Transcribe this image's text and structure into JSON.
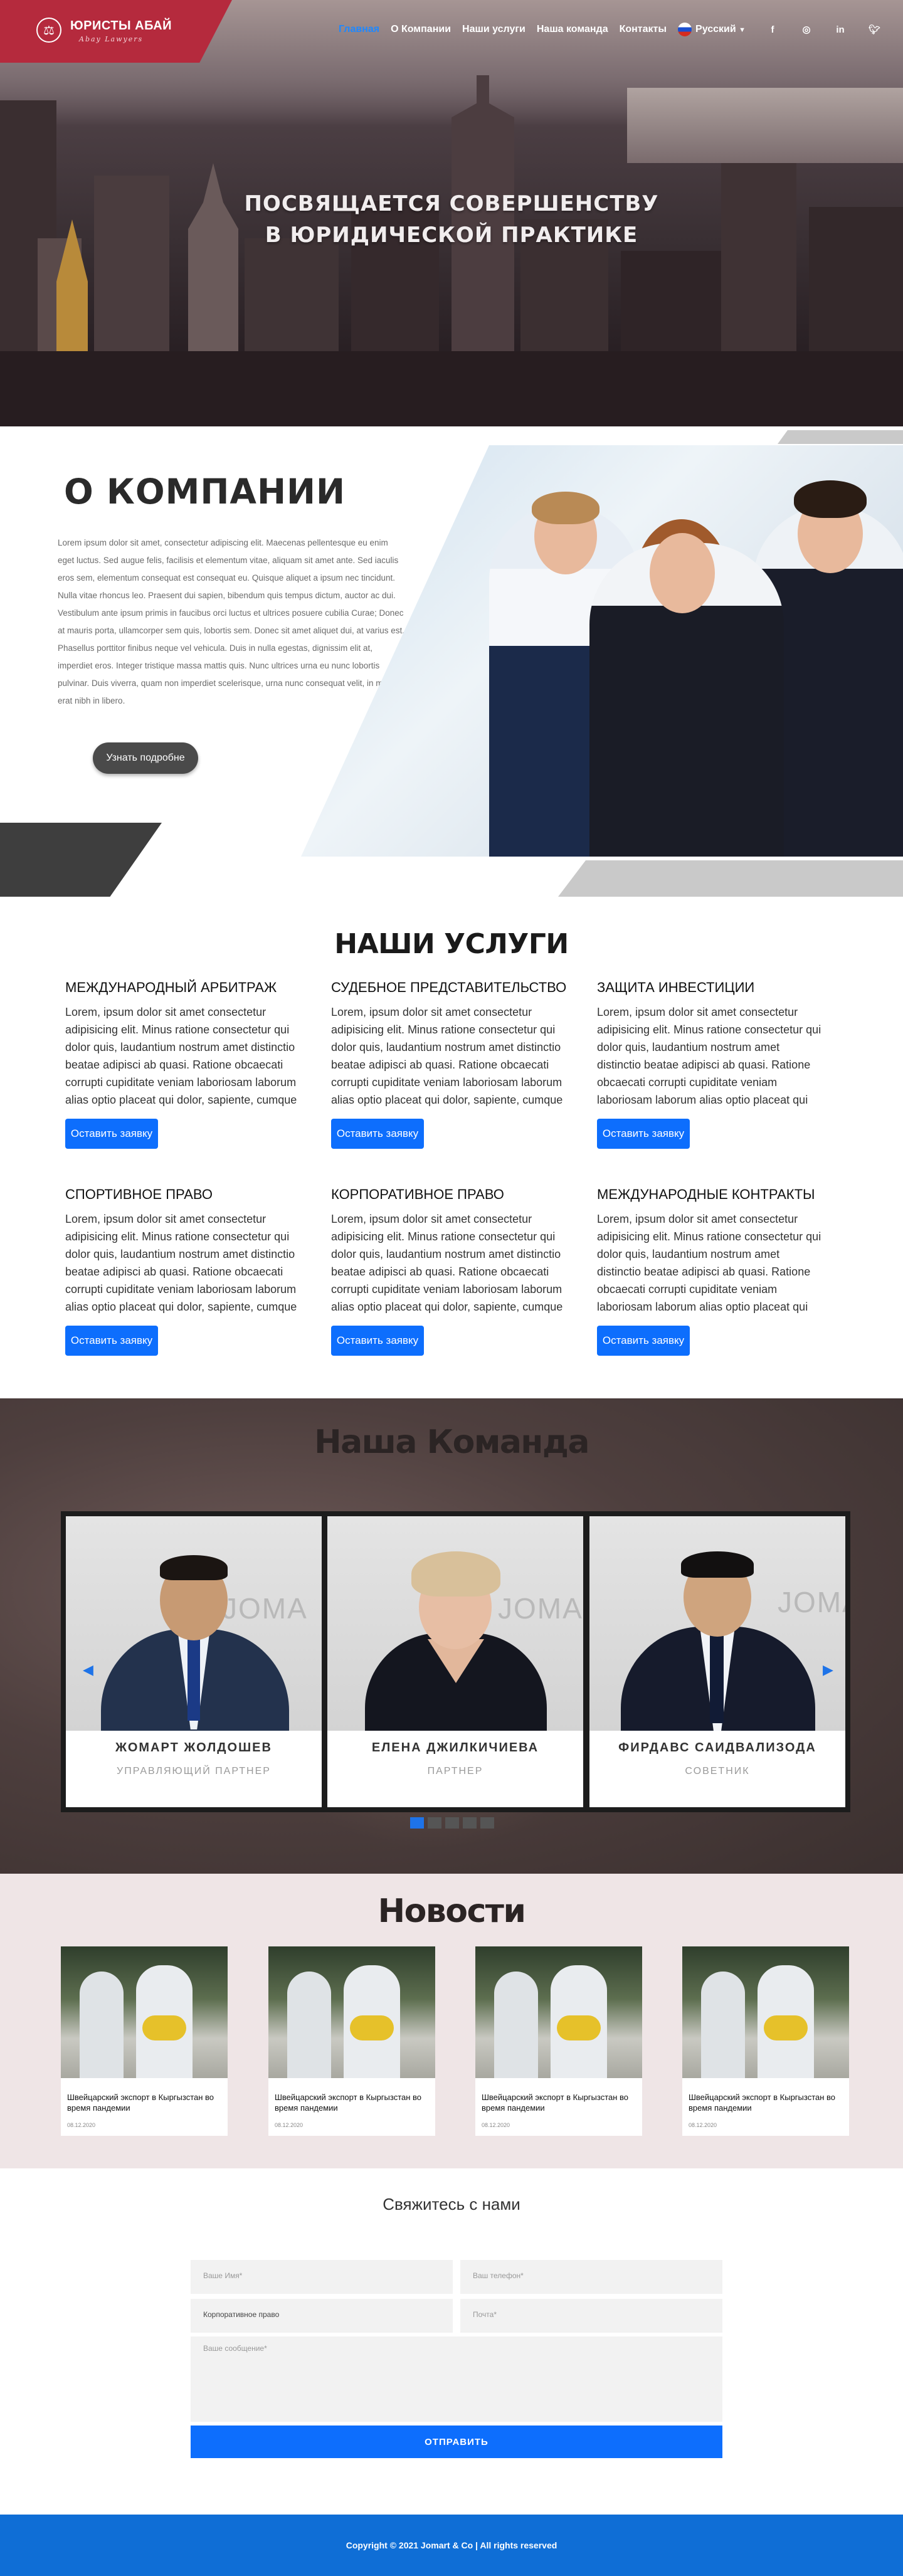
{
  "header": {
    "logo_title": "ЮРИСТЫ АБАЙ",
    "logo_subtitle": "Abay Lawyers",
    "nav": [
      {
        "label": "Главная",
        "active": true
      },
      {
        "label": "О Компании"
      },
      {
        "label": "Наши услуги"
      },
      {
        "label": "Наша команда"
      },
      {
        "label": "Контакты"
      }
    ],
    "language": "Русский",
    "social_icons": [
      "facebook-icon",
      "instagram-icon",
      "linkedin-icon",
      "twitter-icon"
    ]
  },
  "hero": {
    "title_line1": "ПОСВЯЩАЕТСЯ СОВЕРШЕНСТВУ",
    "title_line2": "В ЮРИДИЧЕСКОЙ ПРАКТИКЕ"
  },
  "about": {
    "title": "О КОМПАНИИ",
    "text": "Lorem ipsum dolor sit amet, consectetur adipiscing elit. Maecenas pellentesque eu enim eget luctus. Sed augue felis, facilisis et elementum vitae, aliquam sit amet ante. Sed iaculis eros sem, elementum consequat est consequat eu. Quisque aliquet a ipsum nec tincidunt. Nulla vitae rhoncus leo. Praesent dui sapien, bibendum quis tempus dictum, auctor ac dui. Vestibulum ante ipsum primis in faucibus orci luctus et ultrices posuere cubilia Curae; Donec at mauris porta, ullamcorper sem quis, lobortis sem. Donec sit amet aliquet dui, at varius est. Phasellus porttitor finibus neque vel vehicula. Duis in nulla egestas, dignissim elit at, imperdiet eros. Integer tristique massa mattis quis. Nunc ultrices urna eu nunc lobortis pulvinar. Duis viverra, quam non imperdiet scelerisque, urna nunc consequat velit, in mollis erat nibh in libero.",
    "button": "Узнать подробне"
  },
  "services": {
    "title": "НАШИ УСЛУГИ",
    "items": [
      {
        "title": "МЕЖДУНАРОДНЫЙ АРБИТРАЖ",
        "text": "Lorem, ipsum dolor sit amet consectetur adipisicing elit. Minus ratione consectetur qui dolor quis, laudantium nostrum amet distinctio beatae adipisci ab quasi. Ratione obcaecati corrupti cupiditate veniam laboriosam laborum alias optio placeat qui dolor, sapiente, cumque officia doloremque vitae?",
        "button": "Оставить заявку"
      },
      {
        "title": "СУДЕБНОЕ ПРЕДСТАВИТЕЛЬСТВО",
        "text": "Lorem, ipsum dolor sit amet consectetur adipisicing elit. Minus ratione consectetur qui dolor quis, laudantium nostrum amet distinctio beatae adipisci ab quasi. Ratione obcaecati corrupti cupiditate veniam laboriosam laborum alias optio placeat qui dolor, sapiente, cumque officia doloremque vitae?",
        "button": "Оставить заявку"
      },
      {
        "title": "ЗАЩИТА ИНВЕСТИЦИИ",
        "text": "Lorem, ipsum dolor sit amet consectetur adipisicing elit. Minus ratione consectetur qui dolor quis, laudantium nostrum amet distinctio beatae adipisci ab quasi. Ratione obcaecati corrupti cupiditate veniam laboriosam laborum alias optio placeat qui dolor, sapiente, cumque officia doloremque vitae",
        "button": "Оставить заявку"
      },
      {
        "title": "СПОРТИВНОЕ ПРАВО",
        "text": "Lorem, ipsum dolor sit amet consectetur adipisicing elit. Minus ratione consectetur qui dolor quis, laudantium nostrum amet distinctio beatae adipisci ab quasi. Ratione obcaecati corrupti cupiditate veniam laboriosam laborum alias optio placeat qui dolor, sapiente, cumque officia doloremque vitae?",
        "button": "Оставить заявку"
      },
      {
        "title": "КОРПОРАТИВНОЕ ПРАВО",
        "text": "Lorem, ipsum dolor sit amet consectetur adipisicing elit. Minus ratione consectetur qui dolor quis, laudantium nostrum amet distinctio beatae adipisci ab quasi. Ratione obcaecati corrupti cupiditate veniam laboriosam laborum alias optio placeat qui dolor, sapiente, cumque officia doloremque vitae?",
        "button": "Оставить заявку"
      },
      {
        "title": "МЕЖДУНАРОДНЫЕ КОНТРАКТЫ",
        "text": "Lorem, ipsum dolor sit amet consectetur adipisicing elit. Minus ratione consectetur qui dolor quis, laudantium nostrum amet distinctio beatae adipisci ab quasi. Ratione obcaecati corrupti cupiditate veniam laboriosam laborum alias optio placeat qui dolor, sapiente, cumque officia doloremque vitae?",
        "button": "Оставить заявку"
      }
    ]
  },
  "team": {
    "title": "Наша Команда",
    "members": [
      {
        "name": "ЖОМАРТ ЖОЛДОШЕВ",
        "role": "УПРАВЛЯЮЩИЙ ПАРТНЕР"
      },
      {
        "name": "ЕЛЕНА ДЖИЛКИЧИЕВА",
        "role": "ПАРТНЕР"
      },
      {
        "name": "ФИРДАВС САИДВАЛИЗОДА",
        "role": "СОВЕТНИК"
      }
    ],
    "photo_watermark": "JOMA",
    "slides_total": 5,
    "slide_active": 1
  },
  "news": {
    "title": "Новости",
    "items": [
      {
        "title": "Швейцарский экспорт в Кыргызстан во время пандемии",
        "date": "08.12.2020"
      },
      {
        "title": "Швейцарский экспорт в Кыргызстан во время пандемии",
        "date": "08.12.2020"
      },
      {
        "title": "Швейцарский экспорт в Кыргызстан во время пандемии",
        "date": "08.12.2020"
      },
      {
        "title": "Швейцарский экспорт в Кыргызстан во время пандемии",
        "date": "08.12.2020"
      }
    ]
  },
  "contact": {
    "title": "Свяжитесь с нами",
    "name_placeholder": "Ваше Имя*",
    "phone_placeholder": "Ваш телефон*",
    "service_value": "Корпоративное право",
    "email_placeholder": "Почта*",
    "message_placeholder": "Ваше сообщение*",
    "submit": "ОТПРАВИТЬ"
  },
  "footer": {
    "copyright": "Copyright © 2021 Jomart & Co | All rights reserved"
  },
  "colors": {
    "brand_red": "#b52a3d",
    "accent_blue": "#0d6efd",
    "footer_blue": "#0f6ed6"
  }
}
